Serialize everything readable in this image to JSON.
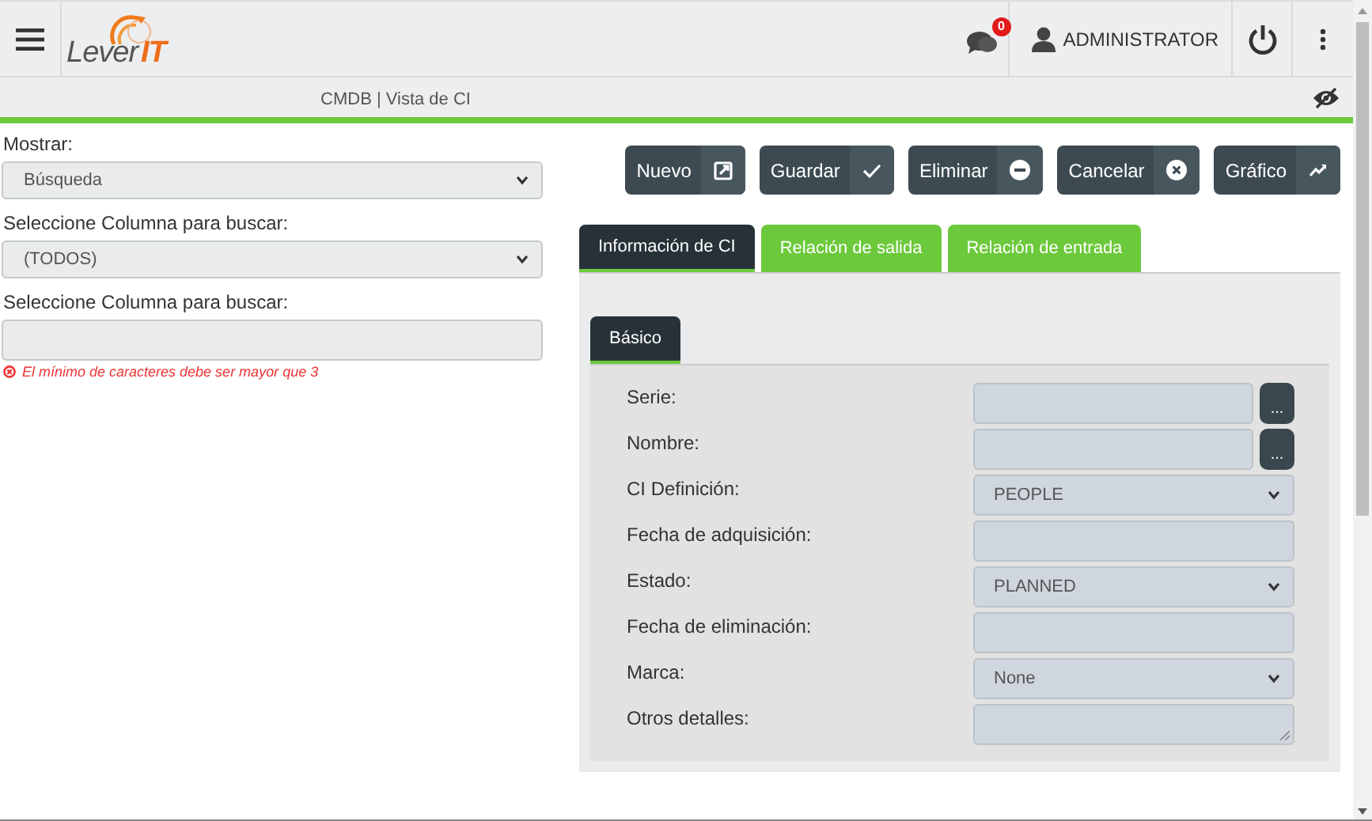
{
  "header": {
    "logo": {
      "name": "Lever",
      "accent": "IT"
    },
    "notifications": {
      "count": "0"
    },
    "user": "ADMINISTRATOR"
  },
  "breadcrumb": "CMDB | Vista de CI",
  "filters": [
    {
      "label": "Mostrar:",
      "kind": "select",
      "value": "Búsqueda"
    },
    {
      "label": "Seleccione Columna para buscar:",
      "kind": "select",
      "value": "(TODOS)"
    },
    {
      "label": "Seleccione Columna para buscar:",
      "kind": "text"
    }
  ],
  "validation_error": "El mínimo de caracteres debe ser mayor que 3",
  "actions": [
    {
      "label": "Nuevo",
      "kind": "new"
    },
    {
      "label": "Guardar",
      "kind": "save"
    },
    {
      "label": "Eliminar",
      "kind": "delete"
    },
    {
      "label": "Cancelar",
      "kind": "cancel"
    },
    {
      "label": "Gráfico",
      "kind": "chart"
    }
  ],
  "tabs": [
    {
      "label": "Información de CI",
      "selected": true
    },
    {
      "label": "Relación de salida",
      "selected": false
    },
    {
      "label": "Relación de entrada",
      "selected": false
    }
  ],
  "subtabs": [
    {
      "label": "Básico",
      "selected": true
    }
  ],
  "fields": [
    {
      "label": "Serie:",
      "kind": "lookup",
      "button": "..."
    },
    {
      "label": "Nombre:",
      "kind": "lookup",
      "button": "..."
    },
    {
      "label": "CI Definición:",
      "kind": "select",
      "value": "PEOPLE"
    },
    {
      "label": "Fecha de adquisición:",
      "kind": "text"
    },
    {
      "label": "Estado:",
      "kind": "select",
      "value": "PLANNED"
    },
    {
      "label": "Fecha de eliminación:",
      "kind": "text"
    },
    {
      "label": "Marca:",
      "kind": "select",
      "value": "None"
    },
    {
      "label": "Otros detalles:",
      "kind": "textarea"
    }
  ]
}
